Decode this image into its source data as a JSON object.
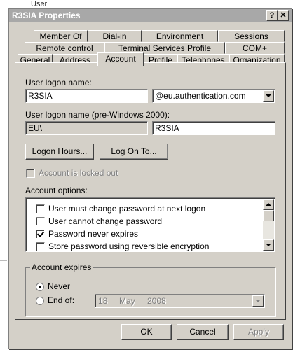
{
  "background": {
    "user_label": "User"
  },
  "window": {
    "title": "R3SIA Properties",
    "help_button": "?",
    "close_button": "✕"
  },
  "tabs": {
    "row1": [
      "Member Of",
      "Dial-in",
      "Environment",
      "Sessions"
    ],
    "row2": [
      "Remote control",
      "Terminal Services Profile",
      "COM+"
    ],
    "row3": [
      "General",
      "Address",
      "Account",
      "Profile",
      "Telephones",
      "Organization"
    ],
    "active": "Account"
  },
  "account": {
    "logon_name_label": "User logon name:",
    "logon_name_value": "R3SIA",
    "domain_value": "@eu.authentication.com",
    "pre2000_label": "User logon name (pre-Windows 2000):",
    "pre2000_domain_value": "EU\\",
    "pre2000_name_value": "R3SIA",
    "logon_hours_button": "Logon Hours...",
    "log_on_to_button": "Log On To...",
    "locked_out_label": "Account is locked out",
    "options_label": "Account options:",
    "options": [
      {
        "label": "User must change password at next logon",
        "checked": false
      },
      {
        "label": "User cannot change password",
        "checked": false
      },
      {
        "label": "Password never expires",
        "checked": true
      },
      {
        "label": "Store password using reversible encryption",
        "checked": false
      }
    ],
    "expires_label": "Account expires",
    "never_label": "Never",
    "end_of_label": "End of:",
    "end_day": "18",
    "end_month": "May",
    "end_year": "2008"
  },
  "footer": {
    "ok_button": "OK",
    "cancel_button": "Cancel",
    "apply_button": "Apply"
  }
}
